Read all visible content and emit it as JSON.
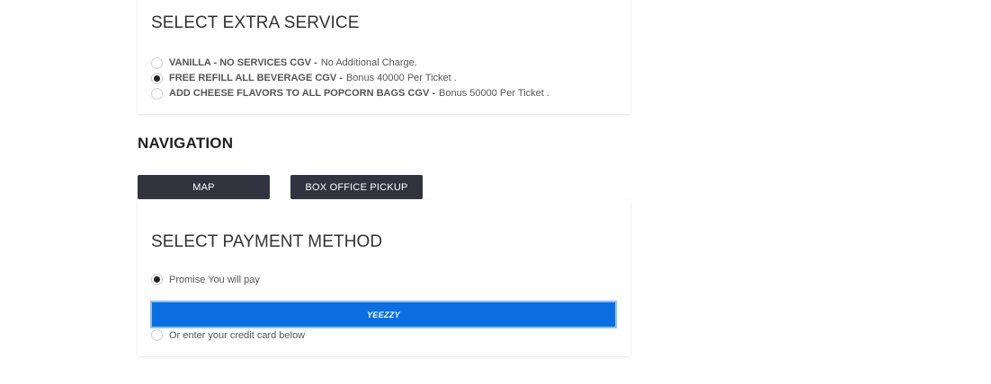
{
  "extra_service": {
    "title": "SELECT EXTRA SERVICE",
    "options": [
      {
        "label": "VANILLA - NO SERVICES CGV -",
        "desc": "No Additional Charge.",
        "selected": false
      },
      {
        "label": "FREE REFILL ALL BEVERAGE CGV -",
        "desc": "Bonus 40000 Per Ticket .",
        "selected": true
      },
      {
        "label": "ADD CHEESE FLAVORS TO ALL POPCORN BAGS CGV -",
        "desc": "Bonus 50000 Per Ticket .",
        "selected": false
      }
    ]
  },
  "navigation": {
    "title": "NAVIGATION",
    "map_label": "MAP",
    "box_office_label": "BOX OFFICE PICKUP"
  },
  "payment": {
    "title": "SELECT PAYMENT METHOD",
    "promise_label": "Promise You will pay",
    "promise_selected": true,
    "yeezy_label": "YEEZZY",
    "credit_label": "Or enter your credit card below",
    "credit_selected": false
  },
  "colors": {
    "nav_button_bg": "#32333f",
    "yeezy_bg": "#0a6fe0"
  }
}
